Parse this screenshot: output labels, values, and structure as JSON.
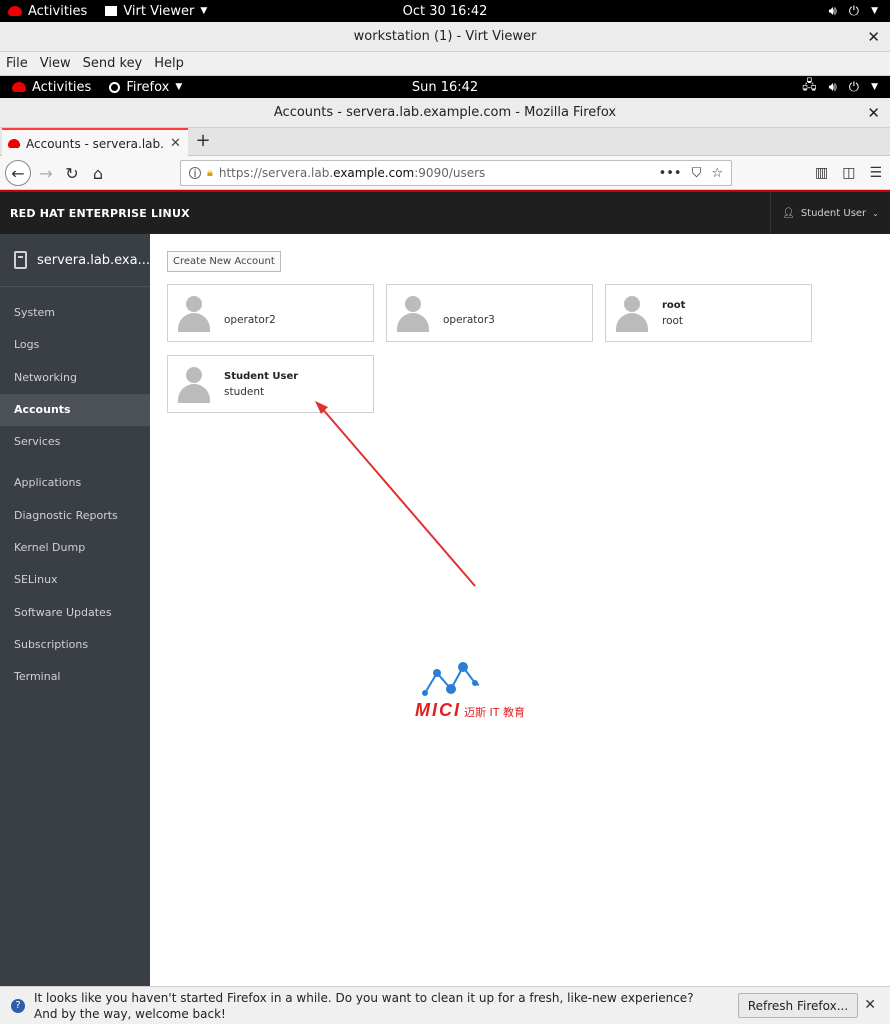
{
  "host_topbar": {
    "activities": "Activities",
    "app": "Virt Viewer",
    "clock": "Oct 30  16:42"
  },
  "host_window": {
    "title": "workstation (1) - Virt Viewer",
    "menu": [
      "File",
      "View",
      "Send key",
      "Help"
    ]
  },
  "guest_topbar": {
    "activities": "Activities",
    "app": "Firefox",
    "clock": "Sun 16:42"
  },
  "firefox": {
    "title": "Accounts - servera.lab.example.com - Mozilla Firefox",
    "tab_title": "Accounts - servera.lab.ex",
    "url_prefix": "https://servera.lab.",
    "url_domain": "example.com",
    "url_suffix": ":9090/users"
  },
  "cockpit": {
    "brand": "RED HAT ENTERPRISE LINUX",
    "user_menu": "Student User",
    "host": "servera.lab.exa...",
    "nav": [
      "System",
      "Logs",
      "Networking",
      "Accounts",
      "Services",
      "Applications",
      "Diagnostic Reports",
      "Kernel Dump",
      "SELinux",
      "Software Updates",
      "Subscriptions",
      "Terminal"
    ],
    "active_nav": "Accounts",
    "create_button": "Create New Account",
    "accounts": [
      {
        "full_name": "",
        "login": "operator2"
      },
      {
        "full_name": "",
        "login": "operator3"
      },
      {
        "full_name": "root",
        "login": "root"
      },
      {
        "full_name": "Student User",
        "login": "student"
      }
    ]
  },
  "watermark": {
    "brand": "MICI",
    "tagline": "迈斯 IT 教育"
  },
  "notification": {
    "message": "It looks like you haven't started Firefox in a while. Do you want to clean it up for a fresh, like-new experience? And by the way, welcome back!",
    "button": "Refresh Firefox..."
  },
  "colors": {
    "accent_red": "#cc0000",
    "sidebar_bg": "#393f44",
    "annotation_arrow": "#e03030"
  }
}
